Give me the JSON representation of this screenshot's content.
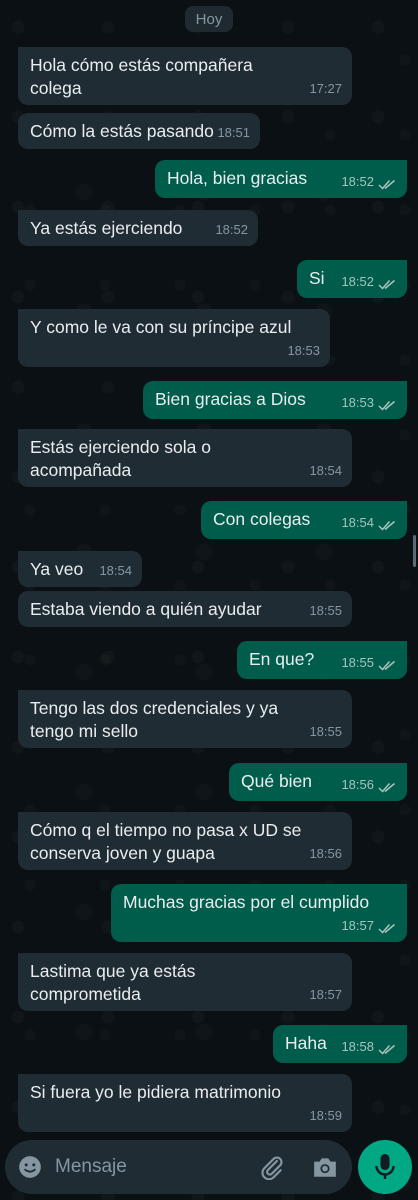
{
  "date_separator": "Hoy",
  "messages": [
    {
      "dir": "in",
      "lines": [
        "Hola cómo estás compañera",
        "colega"
      ],
      "time": "17:27"
    },
    {
      "dir": "in",
      "lines": [
        "Cómo la estás pasando"
      ],
      "time": "18:51"
    },
    {
      "dir": "out",
      "lines": [
        "Hola, bien gracias"
      ],
      "time": "18:52",
      "status": "read"
    },
    {
      "dir": "in",
      "lines": [
        "Ya estás ejerciendo"
      ],
      "time": "18:52"
    },
    {
      "dir": "out",
      "lines": [
        "Si"
      ],
      "time": "18:52",
      "status": "read"
    },
    {
      "dir": "in",
      "lines": [
        "Y como le va con su príncipe azul"
      ],
      "time": "18:53"
    },
    {
      "dir": "out",
      "lines": [
        "Bien gracias a Dios"
      ],
      "time": "18:53",
      "status": "read"
    },
    {
      "dir": "in",
      "lines": [
        "Estás ejerciendo sola o",
        "acompañada"
      ],
      "time": "18:54"
    },
    {
      "dir": "out",
      "lines": [
        "Con colegas"
      ],
      "time": "18:54",
      "status": "read"
    },
    {
      "dir": "in",
      "lines": [
        "Ya veo"
      ],
      "time": "18:54"
    },
    {
      "dir": "in",
      "lines": [
        "Estaba viendo a quién ayudar"
      ],
      "time": "18:55"
    },
    {
      "dir": "out",
      "lines": [
        "En que?"
      ],
      "time": "18:55",
      "status": "read"
    },
    {
      "dir": "in",
      "lines": [
        "Tengo las dos credenciales y ya",
        "tengo mi sello"
      ],
      "time": "18:55"
    },
    {
      "dir": "out",
      "lines": [
        "Qué bien"
      ],
      "time": "18:56",
      "status": "read"
    },
    {
      "dir": "in",
      "lines": [
        "Cómo q el tiempo no pasa x UD se",
        "conserva joven y guapa"
      ],
      "time": "18:56"
    },
    {
      "dir": "out",
      "lines": [
        "Muchas gracias por el cumplido"
      ],
      "time": "18:57",
      "status": "read"
    },
    {
      "dir": "in",
      "lines": [
        "Lastima que ya estás",
        "comprometida"
      ],
      "time": "18:57"
    },
    {
      "dir": "out",
      "lines": [
        "Haha"
      ],
      "time": "18:58",
      "status": "read"
    },
    {
      "dir": "in",
      "lines": [
        "Si fuera yo le pidiera matrimonio"
      ],
      "time": "18:59"
    }
  ],
  "input": {
    "placeholder": "Mensaje"
  },
  "icons": {
    "emoji": "emoji-icon",
    "attach": "paperclip-icon",
    "camera": "camera-icon",
    "mic": "microphone-icon",
    "read": "double-check-icon"
  },
  "colors": {
    "incoming": "#202c33",
    "outgoing": "#005c4b",
    "accent": "#00a884",
    "background": "#0b1014"
  }
}
